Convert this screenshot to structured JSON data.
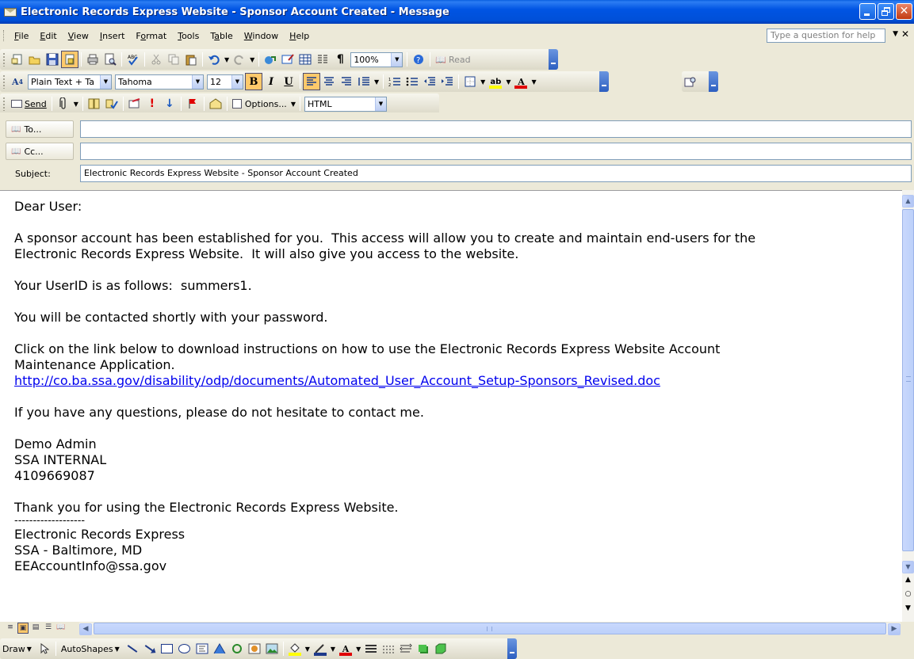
{
  "window": {
    "title": "Electronic Records Express Website - Sponsor Account Created - Message"
  },
  "menubar": {
    "items": [
      {
        "label": "File",
        "u": "F",
        "rest": "ile"
      },
      {
        "label": "Edit",
        "u": "E",
        "rest": "dit"
      },
      {
        "label": "View",
        "u": "V",
        "rest": "iew"
      },
      {
        "label": "Insert",
        "u": "I",
        "rest": "nsert"
      },
      {
        "label": "Format",
        "u": "o",
        "pre": "F",
        "rest": "rmat"
      },
      {
        "label": "Tools",
        "u": "T",
        "rest": "ools"
      },
      {
        "label": "Table",
        "u": "a",
        "pre": "T",
        "rest": "ble"
      },
      {
        "label": "Window",
        "u": "W",
        "rest": "indow"
      },
      {
        "label": "Help",
        "u": "H",
        "rest": "elp"
      }
    ],
    "help_placeholder": "Type a question for help"
  },
  "standard_toolbar": {
    "zoom": "100%",
    "read_label": "Read"
  },
  "formatting_toolbar": {
    "style": "Plain Text + Ta",
    "font": "Tahoma",
    "size": "12"
  },
  "email_toolbar": {
    "send_label": "Send",
    "options_label": "Options...",
    "format": "HTML"
  },
  "header": {
    "to_label": "To...",
    "to_value": "",
    "cc_label": "Cc...",
    "cc_value": "",
    "subject_label": "Subject:",
    "subject_value": "Electronic Records Express Website - Sponsor Account Created"
  },
  "body": {
    "greeting": "Dear User:",
    "para1_line1": "A sponsor account has been established for you.  This access will allow you to create and maintain end-users for the",
    "para1_line2": "Electronic Records Express Website.  It will also give you access to the website.",
    "userid_line": "Your UserID is as follows:  summers1.",
    "password_line": "You will be contacted shortly with your password.",
    "link_intro_line1": "Click on the link below to download instructions on how to use the Electronic Records Express Website Account",
    "link_intro_line2": "Maintenance Application.",
    "link": "http://co.ba.ssa.gov/disability/odp/documents/Automated_User_Account_Setup-Sponsors_Revised.doc",
    "questions_line": "If you have any questions, please do not hesitate to contact me.",
    "sig_name": "Demo Admin",
    "sig_org": "SSA INTERNAL",
    "sig_phone": "4109669087",
    "thanks_line": "Thank you for using the Electronic Records Express Website.",
    "divider": "-------------------",
    "footer_name": "Electronic Records Express",
    "footer_location": "SSA - Baltimore, MD",
    "footer_email": "EEAccountInfo@ssa.gov"
  },
  "drawing_toolbar": {
    "draw_label": "Draw",
    "autoshapes_label": "AutoShapes"
  },
  "colors": {
    "title_bar": "#0054E3",
    "link": "#0000EE",
    "highlight": "#FFC96B",
    "chrome": "#ECE9D8"
  }
}
